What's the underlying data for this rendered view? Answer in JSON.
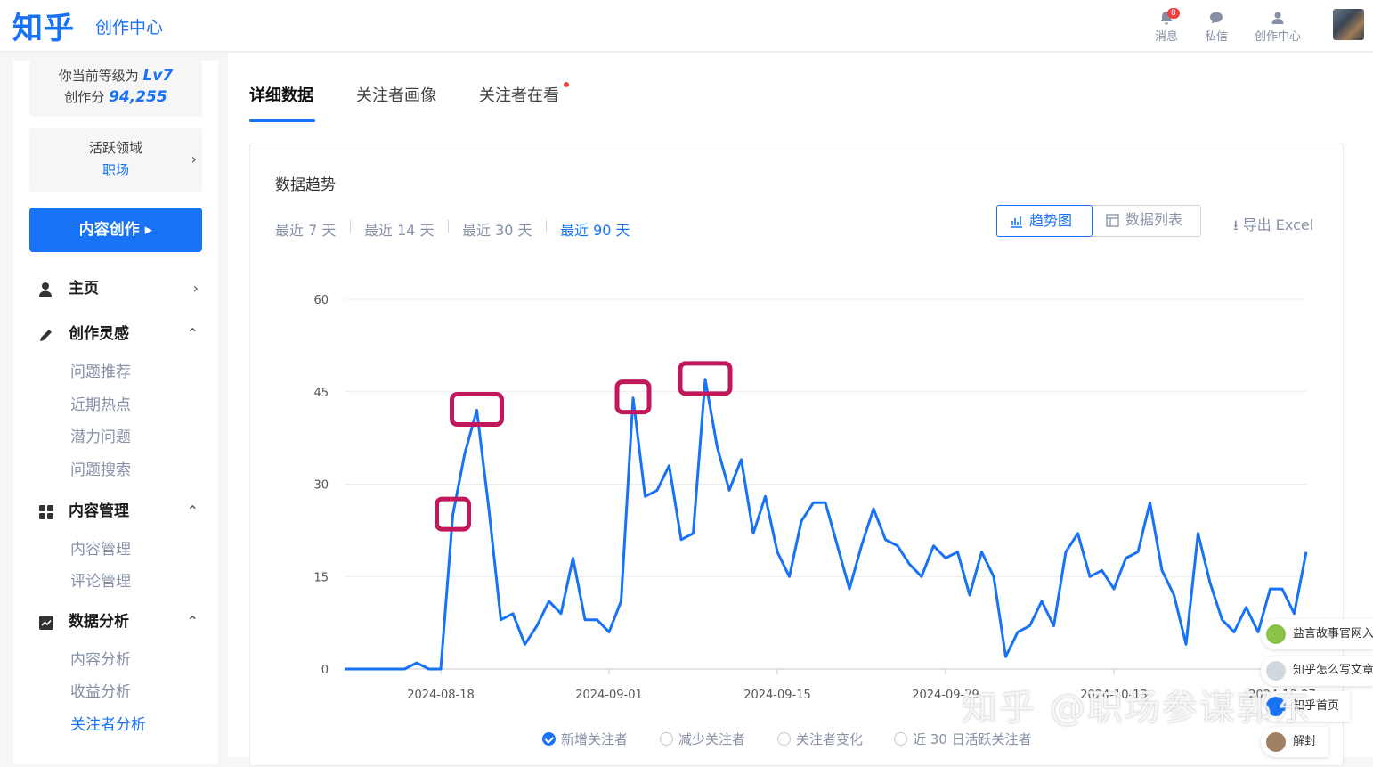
{
  "header": {
    "logo": "知乎",
    "subtitle": "创作中心",
    "icons": [
      {
        "label": "消息",
        "badge": "8"
      },
      {
        "label": "私信"
      },
      {
        "label": "创作中心"
      }
    ]
  },
  "sidebar": {
    "level_prefix": "你当前等级为",
    "level": "Lv7",
    "score_prefix": "创作分",
    "score": "94,255",
    "field_label": "活跃领域",
    "field_value": "职场",
    "create_button": "内容创作 ▸",
    "groups": [
      {
        "label": "主页",
        "chevron": "›",
        "items": []
      },
      {
        "label": "创作灵感",
        "chevron": "⌃",
        "items": [
          "问题推荐",
          "近期热点",
          "潜力问题",
          "问题搜索"
        ]
      },
      {
        "label": "内容管理",
        "chevron": "⌃",
        "items": [
          "内容管理",
          "评论管理"
        ]
      },
      {
        "label": "数据分析",
        "chevron": "⌃",
        "items": [
          "内容分析",
          "收益分析",
          "关注者分析"
        ]
      }
    ]
  },
  "main": {
    "tabs": [
      "详细数据",
      "关注者画像",
      "关注者在看"
    ],
    "panel_title": "数据趋势",
    "ranges": [
      "最近 7 天",
      "最近 14 天",
      "最近 30 天",
      "最近 90 天"
    ],
    "active_range": "最近 90 天",
    "view_trend": "趋势图",
    "view_list": "数据列表",
    "export": "导出 Excel",
    "legend": [
      "新增关注者",
      "减少关注者",
      "关注者变化",
      "近 30 日活跃关注者"
    ]
  },
  "chart_data": {
    "type": "line",
    "title": "",
    "xlabel": "",
    "ylabel": "",
    "ylim": [
      0,
      60
    ],
    "yticks": [
      0,
      15,
      30,
      45,
      60
    ],
    "xtick_labels": [
      "2024-08-18",
      "2024-09-01",
      "2024-09-15",
      "2024-09-29",
      "2024-10-13",
      "2024-10-27"
    ],
    "grid": true,
    "color": "#1772f6",
    "highlight_color": "#c2185b",
    "series": [
      {
        "name": "新增关注者",
        "values": [
          0,
          0,
          0,
          0,
          0,
          0,
          1,
          0,
          0,
          25,
          35,
          42,
          26,
          8,
          9,
          4,
          7,
          11,
          9,
          18,
          8,
          8,
          6,
          11,
          44,
          28,
          29,
          33,
          21,
          22,
          47,
          36,
          29,
          34,
          22,
          28,
          19,
          15,
          24,
          27,
          27,
          20,
          13,
          20,
          26,
          21,
          20,
          17,
          15,
          20,
          18,
          19,
          12,
          19,
          15,
          2,
          6,
          7,
          11,
          7,
          19,
          22,
          15,
          16,
          13,
          18,
          19,
          27,
          16,
          12,
          4,
          22,
          14,
          8,
          6,
          10,
          6,
          13,
          13,
          9,
          19
        ]
      }
    ],
    "highlighted_points": [
      9,
      11,
      24,
      30
    ]
  },
  "floating": [
    "盐言故事官网入",
    "知乎怎么写文章",
    "知乎首页",
    "解封"
  ],
  "watermark": "知乎 @职场参谋郭东"
}
